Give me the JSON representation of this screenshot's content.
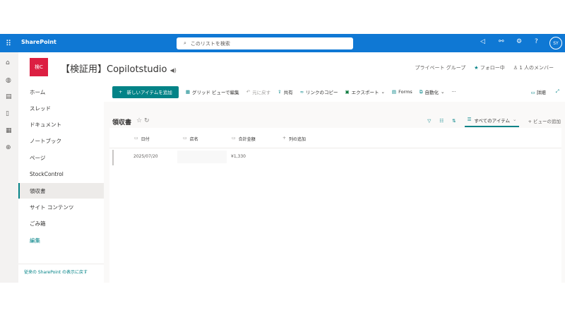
{
  "topbar": {
    "brand": "SharePoint",
    "search_placeholder": "このリストを検索",
    "avatar": "SY"
  },
  "site": {
    "logo": "検C",
    "title": "【検証用】Copilotstudio",
    "privacy": "プライベート グループ",
    "follow": "フォロー中",
    "members": "1 人のメンバー"
  },
  "nav": {
    "items": [
      "ホーム",
      "スレッド",
      "ドキュメント",
      "ノートブック",
      "ページ",
      "StockControl",
      "領収書",
      "サイト コンテンツ",
      "ごみ箱"
    ],
    "edit": "編集",
    "footer": "従来の SharePoint の表示に戻す"
  },
  "commands": {
    "new": "新しいアイテムを追加",
    "grid": "グリッド ビューで編集",
    "undo": "元に戻す",
    "share": "共有",
    "copylink": "リンクのコピー",
    "export": "エクスポート",
    "forms": "Forms",
    "automate": "自動化",
    "more": "···",
    "details": "詳細"
  },
  "list": {
    "title": "領収書",
    "view": "すべてのアイテム",
    "add_view": "ビューの追加",
    "columns": [
      "日付",
      "店名",
      "合計金額"
    ],
    "add_column": "列の追加",
    "rows": [
      {
        "date": "2025/07/20",
        "store": "",
        "total": "¥1,330"
      }
    ]
  },
  "colors": {
    "topbar": "#0f78d4",
    "accent": "#038387",
    "logo": "#dc1f42"
  }
}
